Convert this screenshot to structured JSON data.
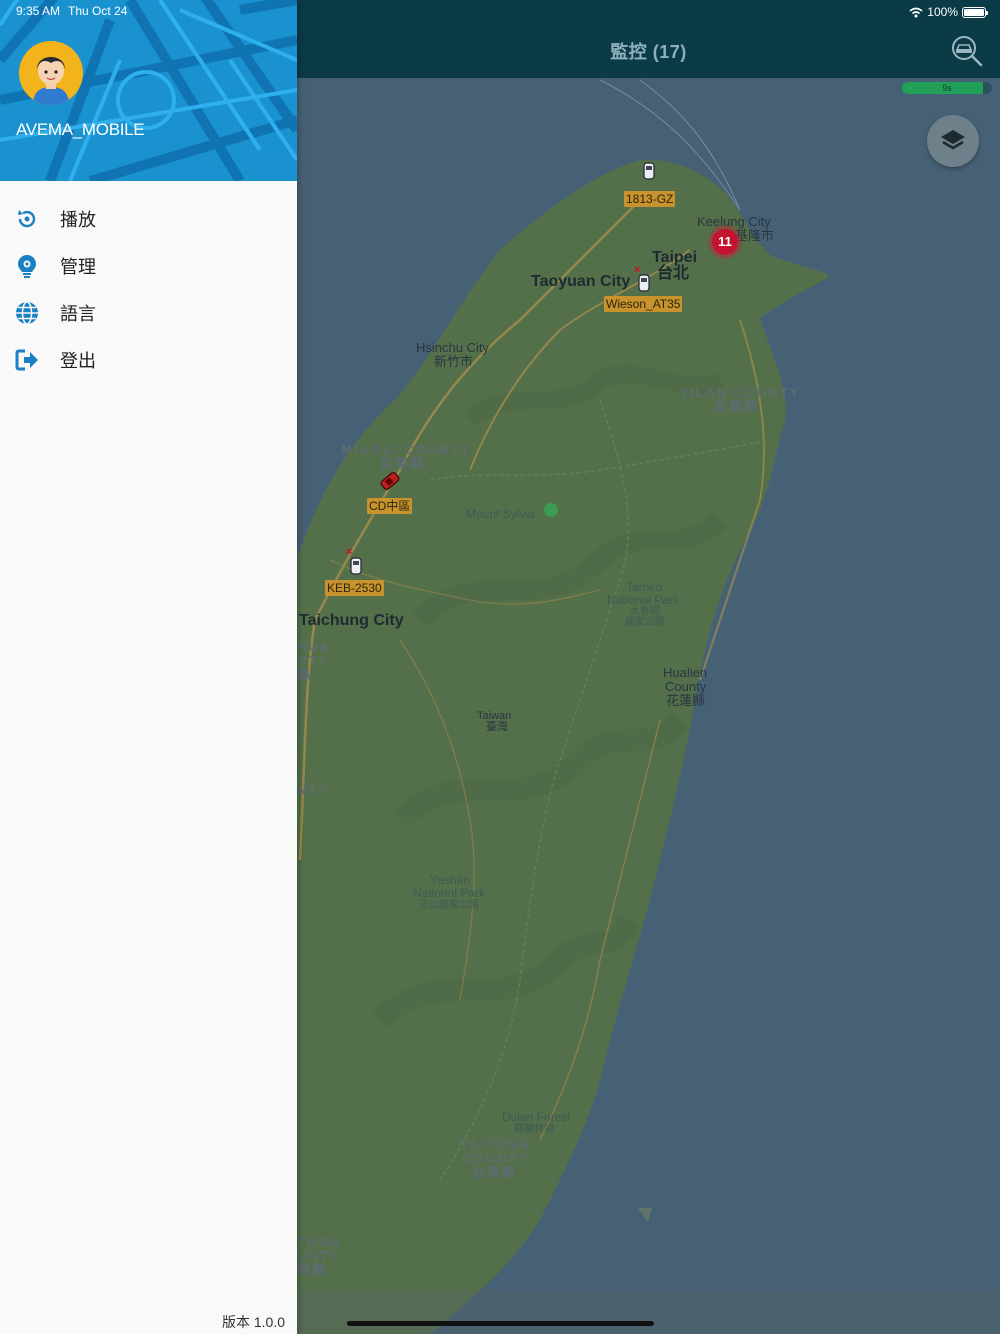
{
  "status_bar": {
    "time": "9:35 AM",
    "date": "Thu Oct 24",
    "battery": "100%"
  },
  "navbar": {
    "title": "監控 (17)"
  },
  "refresh": {
    "label": "9s",
    "fraction": 0.9
  },
  "drawer": {
    "username": "AVEMA_MOBILE",
    "menu": [
      {
        "label": "播放",
        "icon": "replay-icon"
      },
      {
        "label": "管理",
        "icon": "gear-bulb-icon"
      },
      {
        "label": "語言",
        "icon": "globe-icon"
      },
      {
        "label": "登出",
        "icon": "logout-icon"
      }
    ],
    "version": "版本 1.0.0"
  },
  "map": {
    "cluster_count": "11",
    "vehicles": [
      {
        "plate": "1813-GZ"
      },
      {
        "plate": "Wieson_AT35"
      },
      {
        "plate": "CD中區"
      },
      {
        "plate": "KEB-2530"
      }
    ],
    "places": {
      "keelung": "Keelung City",
      "keelung_zh": "基隆市",
      "taipei": "Taipei",
      "taipei_zh": "台北",
      "taoyuan": "Taoyuan City",
      "hsinchu": "Hsinchu City",
      "hsinchu_zh": "新竹市",
      "yilan": "YILAN COUNTY",
      "yilan_zh": "宜蘭縣",
      "miaoli": "MIAOLI COUNTY",
      "miaoli_zh": "苗栗縣",
      "sylvia": "Mount Sylvia",
      "taroko_1": "Taroko",
      "taroko_2": "National Park",
      "taroko_zh_1": "太魯閣",
      "taroko_zh_2": "國家公園",
      "taichung": "Taichung City",
      "hualien_1": "Hualien",
      "hualien_2": "County",
      "hualien_zh": "花蓮縣",
      "taiwan": "Taiwan",
      "taiwan_zh": "臺灣",
      "changhua_1": "HUA",
      "changhua_2": "NTY",
      "changhua_zh": "縣",
      "nantou": "NTY",
      "yushan_1": "Yushan",
      "yushan_2": "National Park",
      "yushan_zh": "玉山國家公園",
      "dulan": "Dulan Forest",
      "dulan_zh": "都蘭林場",
      "taitung_1": "TAITUNG",
      "taitung_2": "COUNTY",
      "taitung_zh": "台東縣",
      "pingtung_1": "TUNG",
      "pingtung_2": "UNTY",
      "pingtung_zh": "東縣"
    }
  },
  "colors": {
    "navbar": "#0c3b48",
    "drawer_header": "#1a92cf",
    "icon_blue": "#1a7fc3",
    "cluster": "#c41230",
    "plate": "#c8922c",
    "progress": "#22a05a"
  }
}
